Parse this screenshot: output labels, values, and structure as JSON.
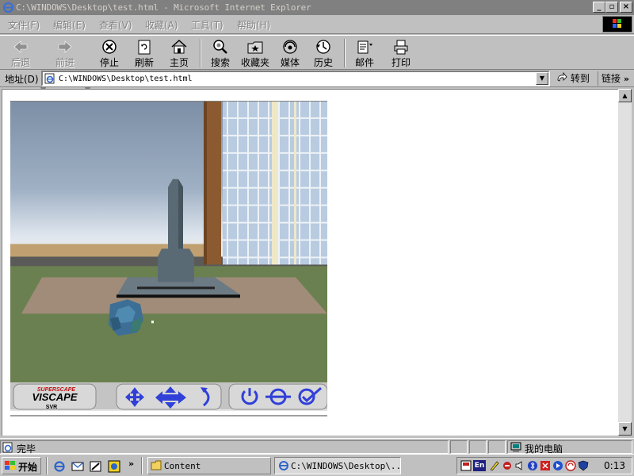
{
  "window": {
    "title": "C:\\WINDOWS\\Desktop\\test.html - Microsoft Internet Explorer"
  },
  "menu": {
    "items": [
      "文件(F)",
      "编辑(E)",
      "查看(V)",
      "收藏(A)",
      "工具(T)",
      "帮助(H)"
    ]
  },
  "toolbar": {
    "back": "后退",
    "forward": "前进",
    "stop": "停止",
    "refresh": "刷新",
    "home": "主页",
    "search": "搜索",
    "favorites": "收藏夹",
    "media": "媒体",
    "history": "历史",
    "mail": "邮件",
    "print": "打印"
  },
  "address": {
    "label": "地址(D)",
    "value": "C:\\WINDOWS\\Desktop\\test.html",
    "go": "转到",
    "links": "链接"
  },
  "plugin": {
    "brand_top": "SUPERSCAPE",
    "brand_main": "VISCAPE",
    "brand_sub": "SVR"
  },
  "status": {
    "text": "完毕",
    "zone": "我的电脑"
  },
  "taskbar": {
    "start": "开始",
    "tasks": [
      "Content",
      "C:\\WINDOWS\\Desktop\\..."
    ],
    "tray_lang": "En",
    "clock": "0:13"
  },
  "colors": {
    "title_inactive": "#808080",
    "chrome": "#c0c0c0",
    "viscape_blue": "#3040d8"
  }
}
